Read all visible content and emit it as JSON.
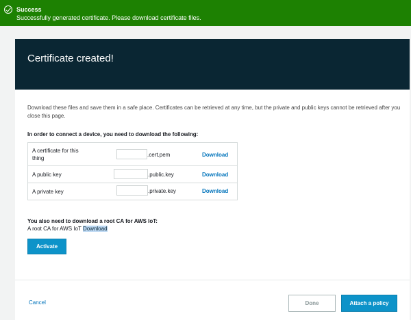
{
  "banner": {
    "title": "Success",
    "message": "Successfully generated certificate. Please download certificate files.",
    "icon": "check-circle-icon",
    "color": "#1d8102"
  },
  "header": {
    "title": "Certificate created!"
  },
  "intro": "Download these files and save them in a safe place. Certificates can be retrieved at any time, but the private and public keys cannot be retrieved after you close this page.",
  "files": {
    "section_title": "In order to connect a device, you need to download the following:",
    "rows": [
      {
        "label": "A certificate for this thing",
        "suffix": ".cert.pem",
        "download": "Download"
      },
      {
        "label": "A public key",
        "suffix": ".public.key",
        "download": "Download"
      },
      {
        "label": "A private key",
        "suffix": ".private.key",
        "download": "Download"
      }
    ]
  },
  "rootca": {
    "title": "You also need to download a root CA for AWS IoT:",
    "label": "A root CA for AWS IoT",
    "link": "Download"
  },
  "buttons": {
    "activate": "Activate",
    "cancel": "Cancel",
    "done": "Done",
    "attach": "Attach a policy"
  },
  "colors": {
    "header_bg": "#0a2633",
    "primary": "#0d93c9",
    "link": "#0073bb"
  }
}
